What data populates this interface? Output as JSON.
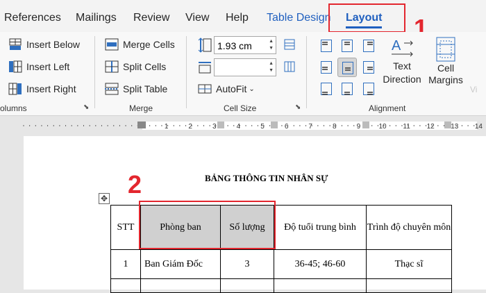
{
  "tabs": {
    "references": "References",
    "mailings": "Mailings",
    "review": "Review",
    "view": "View",
    "help": "Help",
    "table_design": "Table Design",
    "layout": "Layout"
  },
  "rows_columns": {
    "insert_below": "Insert Below",
    "insert_left": "Insert Left",
    "insert_right": "Insert Right",
    "group_label": "olumns"
  },
  "merge": {
    "merge_cells": "Merge Cells",
    "split_cells": "Split Cells",
    "split_table": "Split Table",
    "group_label": "Merge"
  },
  "cell_size": {
    "height_value": "1.93 cm",
    "width_value": "",
    "autofit": "AutoFit",
    "group_label": "Cell Size"
  },
  "alignment": {
    "text_direction_line1": "Text",
    "text_direction_line2": "Direction",
    "cell_margins_line1": "Cell",
    "cell_margins_line2": "Margins",
    "group_label": "Alignment",
    "selected_index": 4
  },
  "ruler": {
    "numbers": [
      "1",
      "2",
      "3",
      "4",
      "5",
      "6",
      "7",
      "8",
      "9",
      "10",
      "11",
      "12",
      "13",
      "14"
    ]
  },
  "document": {
    "title": "BẢNG THÔNG TIN NHÂN SỰ",
    "headers": [
      "STT",
      "Phòng ban",
      "Số lượng",
      "Độ tuổi trung bình",
      "Trình độ chuyên môn"
    ],
    "rows": [
      [
        "1",
        "Ban Giám Đốc",
        "3",
        "36-45; 46-60",
        "Thạc sĩ"
      ]
    ]
  },
  "annotations": {
    "marker_1": "1",
    "marker_2": "2"
  },
  "colors": {
    "accent": "#1f5fbf",
    "annotation_red": "#e3262e",
    "header_shade": "#d0d0d0"
  }
}
